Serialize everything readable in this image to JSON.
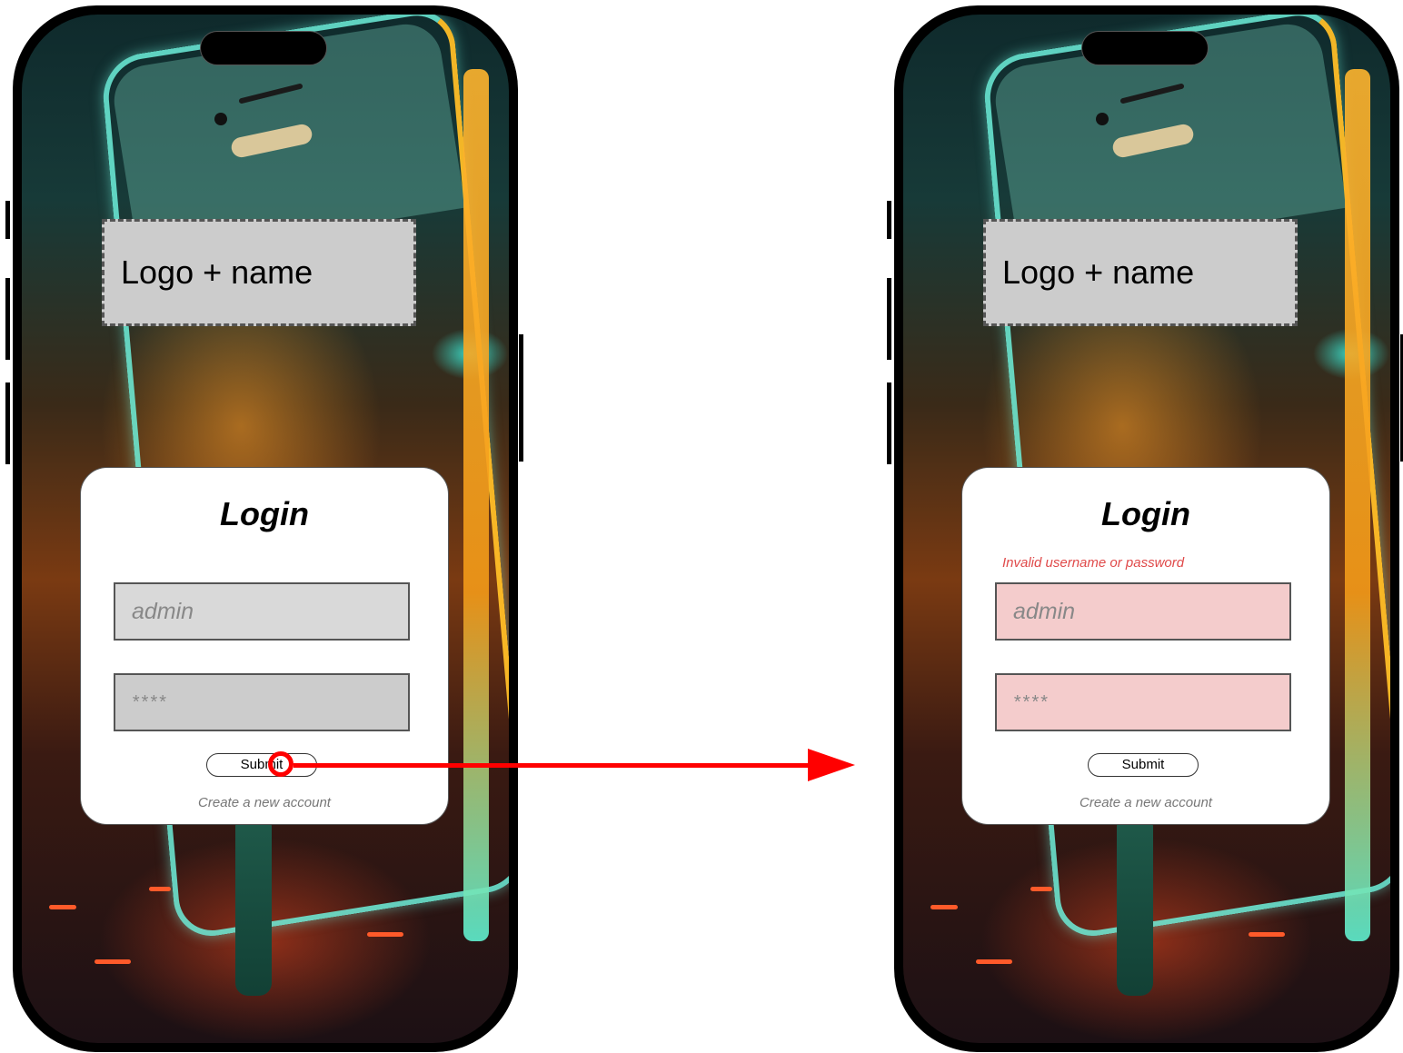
{
  "before_screen": {
    "logo_placeholder": "Logo + name",
    "login_title": "Login",
    "username_placeholder": "admin",
    "password_placeholder": "****",
    "submit_label": "Submit",
    "create_account_label": "Create a new account"
  },
  "after_screen": {
    "logo_placeholder": "Logo + name",
    "login_title": "Login",
    "error_message": "Invalid username or password",
    "username_placeholder": "admin",
    "password_placeholder": "****",
    "submit_label": "Submit",
    "create_account_label": "Create a new account"
  },
  "colors": {
    "error_text": "#e04a4a",
    "error_field_bg": "#f4cccc",
    "flow_arrow": "#ff0000",
    "field_bg": "#d9d9d9",
    "logo_box_bg": "#cccccc"
  },
  "icons": [
    "click-indicator-icon",
    "arrow-right-icon"
  ]
}
